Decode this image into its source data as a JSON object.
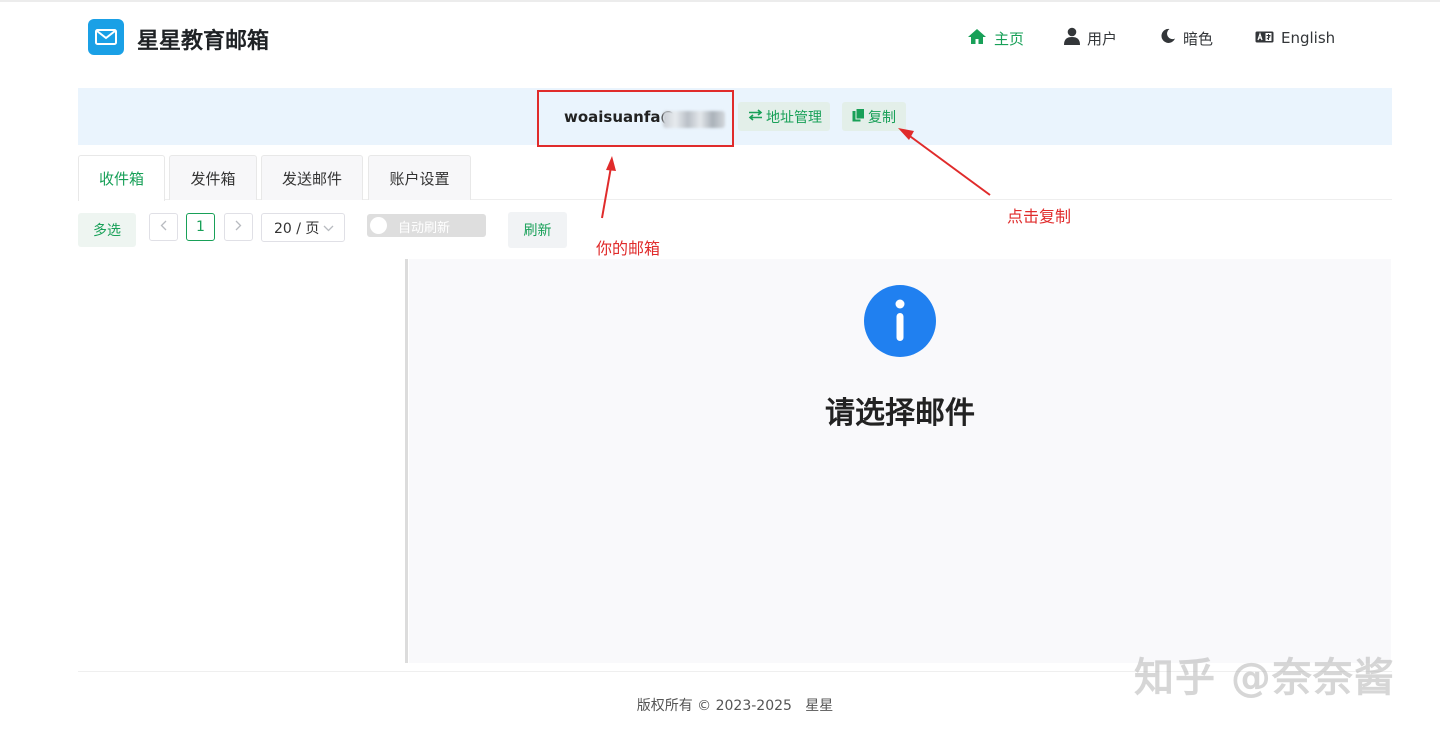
{
  "header": {
    "brand": "星星教育邮箱",
    "logo_icon": "mail-icon",
    "nav": {
      "home": "主页",
      "user": "用户",
      "dark": "暗色",
      "lang": "English"
    }
  },
  "address_bar": {
    "address_prefix": "woaisuanfa@",
    "manage_label": "地址管理",
    "copy_label": "复制"
  },
  "tabs": {
    "inbox": "收件箱",
    "sent": "发件箱",
    "send": "发送邮件",
    "account": "账户设置"
  },
  "toolbar": {
    "multi_select": "多选",
    "current_page": "1",
    "page_size": "20 / 页",
    "auto_refresh": "自动刷新",
    "refresh": "刷新"
  },
  "annotations": {
    "mailbox_note": "你的邮箱",
    "copy_note": "点击复制"
  },
  "main": {
    "empty_title": "请选择邮件"
  },
  "footer": {
    "copyright": "版权所有 © 2023-2025   星星"
  },
  "watermark": "知乎 @奈奈酱",
  "colors": {
    "accent": "#18a058",
    "annotation": "#e02b2b",
    "info": "#2080f0",
    "logo": "#1aa0e6"
  }
}
